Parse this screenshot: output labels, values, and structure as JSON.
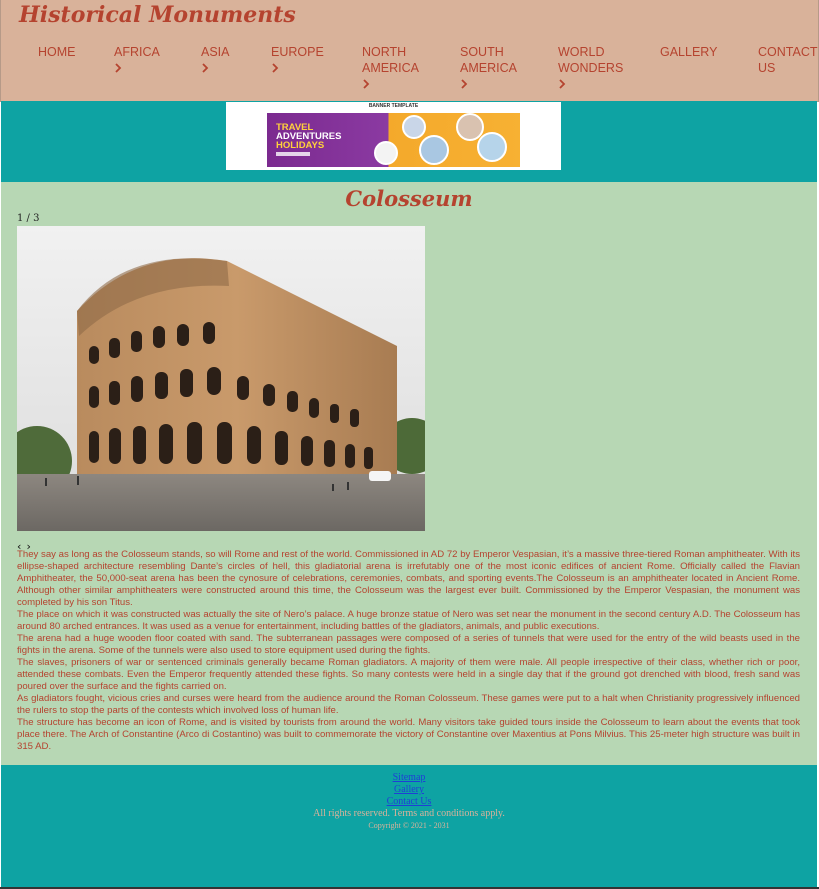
{
  "brand": "Historical Monuments",
  "nav": {
    "home": "HOME",
    "africa": "AFRICA",
    "asia": "ASIA",
    "europe": "EUROPE",
    "north_america_1": "NORTH",
    "north_america_2": "AMERICA",
    "south_america_1": "SOUTH",
    "south_america_2": "AMERICA",
    "world_wonders_1": "WORLD",
    "world_wonders_2": "WONDERS",
    "gallery": "GALLERY",
    "contact_1": "CONTACT",
    "contact_2": "US"
  },
  "banner": {
    "heading": "BANNER TEMPLATE",
    "line1": "TRAVEL",
    "line2": "ADVENTURES",
    "line3": "HOLIDAYS"
  },
  "page_title": "Colosseum",
  "slideshow": {
    "counter": "1 / 3",
    "prev": "‹",
    "next": "›"
  },
  "paragraphs": [
    "They say as long as the Colosseum stands, so will Rome and rest of the world. Commissioned in AD 72 by Emperor Vespasian, it’s a massive three-tiered Roman amphitheater. With its ellipse-shaped architecture resembling Dante’s circles of hell, this gladiatorial arena is irrefutably one of the most iconic edifices of ancient Rome. Officially called the Flavian Amphitheater, the 50,000-seat arena has been the cynosure of celebrations, ceremonies, combats, and sporting events.The Colosseum is an amphitheater located in Ancient Rome. Although other similar amphitheaters were constructed around this time, the Colosseum was the largest ever built. Commissioned by the Emperor Vespasian, the monument was completed by his son Titus.",
    "The place on which it was constructed was actually the site of Nero’s palace. A huge bronze statue of Nero was set near the monument in the second century A.D. The Colosseum has around 80 arched entrances. It was used as a venue for entertainment, including battles of the gladiators, animals, and public executions.",
    "The arena had a huge wooden floor coated with sand. The subterranean passages were composed of a series of tunnels that were used for the entry of the wild beasts used in the fights in the arena. Some of the tunnels were also used to store equipment used during the fights.",
    "The slaves, prisoners of war or sentenced criminals generally became Roman gladiators. A majority of them were male. All people irrespective of their class, whether rich or poor, attended these combats. Even the Emperor frequently attended these fights. So many contests were held in a single day that if the ground got drenched with blood, fresh sand was poured over the surface and the fights carried on.",
    "As gladiators fought, vicious cries and curses were heard from the audience around the Roman Colosseum. These games were put to a halt when Christianity progressively influenced the rulers to stop the parts of the contests which involved loss of human life.",
    "The structure has become an icon of Rome, and is visited by tourists from around the world. Many visitors take guided tours inside the Colosseum to learn about the events that took place there. The Arch of Constantine (Arco di Costantino) was built to commemorate the victory of Constantine over Maxentius at Pons Milvius. This 25-meter high structure was built in 315 AD."
  ],
  "footer": {
    "sitemap": "Sitemap",
    "gallery": "Gallery",
    "contact": "Contact Us",
    "rights": "All rights reserved. Terms and conditions apply.",
    "copyright": "Copyright © 2021 - 2031"
  },
  "colors": {
    "header_bg": "#d9b29a",
    "accent": "#b5432f",
    "teal": "#0ea3a3",
    "content_bg": "#b7d7b4",
    "link": "#1f3fd6"
  },
  "icons": {
    "nav_expand": "chevron-right-icon"
  }
}
